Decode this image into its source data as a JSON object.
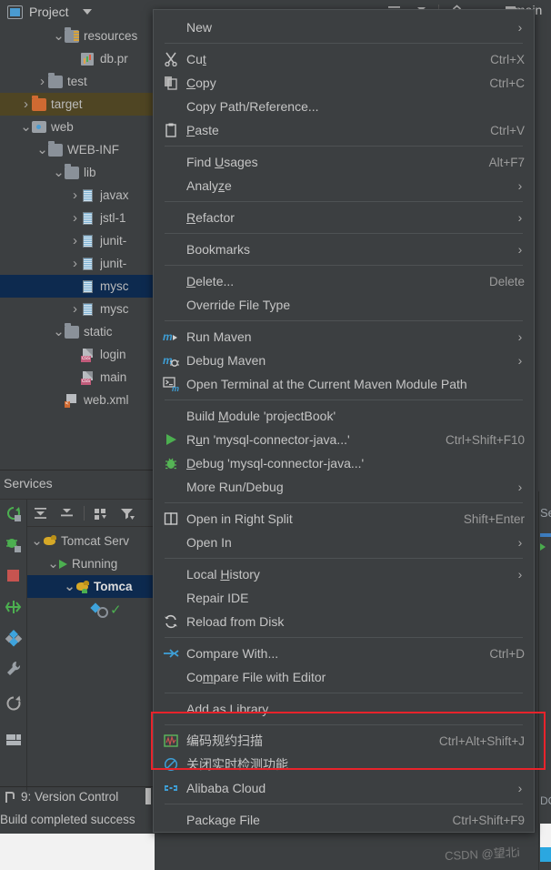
{
  "window": {
    "project_tab_label": "Project",
    "main_branch_label": "main"
  },
  "toolbar": {
    "icons": [
      {
        "name": "expand-all-icon",
        "title": "Expand All"
      },
      {
        "name": "collapse-all-icon",
        "title": "Collapse All"
      },
      {
        "name": "settings-gear-icon",
        "title": "Settings"
      },
      {
        "name": "hide-icon",
        "title": "Hide"
      },
      {
        "name": "vcs-branch-icon",
        "title": "Git Branch"
      }
    ]
  },
  "project_tree": [
    {
      "indent": 3,
      "chevron": "v",
      "icon": "folder-resources-icon",
      "label": "resources",
      "selected": false
    },
    {
      "indent": 4,
      "chevron": "",
      "icon": "properties-file-icon",
      "label": "db.pr",
      "selected": false
    },
    {
      "indent": 2,
      "chevron": ">",
      "icon": "folder-icon",
      "label": "test",
      "selected": false
    },
    {
      "indent": 1,
      "chevron": ">",
      "icon": "folder-target-icon",
      "label": "target",
      "selected": "target"
    },
    {
      "indent": 1,
      "chevron": "v",
      "icon": "web-module-icon",
      "label": "web",
      "selected": false
    },
    {
      "indent": 2,
      "chevron": "v",
      "icon": "folder-icon",
      "label": "WEB-INF",
      "selected": false
    },
    {
      "indent": 3,
      "chevron": "v",
      "icon": "folder-icon",
      "label": "lib",
      "selected": false
    },
    {
      "indent": 4,
      "chevron": ">",
      "icon": "jar-icon",
      "label": "javax",
      "selected": false
    },
    {
      "indent": 4,
      "chevron": ">",
      "icon": "jar-icon",
      "label": "jstl-1",
      "selected": false
    },
    {
      "indent": 4,
      "chevron": ">",
      "icon": "jar-icon",
      "label": "junit-",
      "selected": false
    },
    {
      "indent": 4,
      "chevron": ">",
      "icon": "jar-icon",
      "label": "junit-",
      "selected": false
    },
    {
      "indent": 4,
      "chevron": "",
      "icon": "jar-icon",
      "label": "mysc",
      "selected": "blue"
    },
    {
      "indent": 4,
      "chevron": ">",
      "icon": "jar-icon",
      "label": "mysc",
      "selected": false
    },
    {
      "indent": 3,
      "chevron": "v",
      "icon": "folder-icon",
      "label": "static",
      "selected": false
    },
    {
      "indent": 4,
      "chevron": "",
      "icon": "css-file-icon",
      "label": "login",
      "selected": false
    },
    {
      "indent": 4,
      "chevron": "",
      "icon": "css-file-icon",
      "label": "main",
      "selected": false
    },
    {
      "indent": 3,
      "chevron": "",
      "icon": "xml-file-icon",
      "label": "web.xml",
      "selected": false
    }
  ],
  "services": {
    "title": "Services",
    "toolbar_icons": [
      {
        "name": "expand-all-icon"
      },
      {
        "name": "collapse-all-icon"
      },
      {
        "name": "group-by-icon"
      },
      {
        "name": "filter-icon"
      }
    ],
    "sidebar_icons": [
      {
        "name": "rerun-icon"
      },
      {
        "name": "rerun-debug-icon"
      },
      {
        "name": "stop-icon"
      },
      {
        "name": "redeploy-icon"
      },
      {
        "name": "deploy-icon"
      },
      {
        "name": "wrench-settings-icon"
      },
      {
        "name": "refresh-icon"
      },
      {
        "name": "layout-icon"
      }
    ],
    "tree": [
      {
        "indent": 0,
        "chevron": "v",
        "icon": "tomcat-icon",
        "label": "Tomcat Serv",
        "selected": false,
        "bold": false
      },
      {
        "indent": 1,
        "chevron": "v",
        "icon": "play-icon",
        "label": "Running",
        "selected": false,
        "bold": false
      },
      {
        "indent": 2,
        "chevron": "v",
        "icon": "tomcat-run-icon",
        "label": "Tomca",
        "selected": true,
        "bold": true
      },
      {
        "indent": 3,
        "chevron": "",
        "icon": "deployment-icon",
        "label": "",
        "selected": false,
        "bold": false
      }
    ]
  },
  "status_bar": {
    "vcs_label": "9: Version Control",
    "build_message": "Build completed success"
  },
  "right_edge": {
    "se_label": "Se",
    "doc_label": "DO"
  },
  "context_menu": {
    "items": [
      {
        "type": "item",
        "icon": "",
        "label": "New",
        "shortcut": "",
        "arrow": true,
        "mnemonic": ""
      },
      {
        "type": "sep"
      },
      {
        "type": "item",
        "icon": "cut-icon",
        "label": "Cut",
        "shortcut": "Ctrl+X",
        "arrow": false,
        "mnemonic": "t"
      },
      {
        "type": "item",
        "icon": "copy-icon",
        "label": "Copy",
        "shortcut": "Ctrl+C",
        "arrow": false,
        "mnemonic": "C"
      },
      {
        "type": "item",
        "icon": "",
        "label": "Copy Path/Reference...",
        "shortcut": "",
        "arrow": false,
        "mnemonic": ""
      },
      {
        "type": "item",
        "icon": "paste-icon",
        "label": "Paste",
        "shortcut": "Ctrl+V",
        "arrow": false,
        "mnemonic": "P"
      },
      {
        "type": "sep"
      },
      {
        "type": "item",
        "icon": "",
        "label": "Find Usages",
        "shortcut": "Alt+F7",
        "arrow": false,
        "mnemonic": "U"
      },
      {
        "type": "item",
        "icon": "",
        "label": "Analyze",
        "shortcut": "",
        "arrow": true,
        "mnemonic": "z"
      },
      {
        "type": "sep"
      },
      {
        "type": "item",
        "icon": "",
        "label": "Refactor",
        "shortcut": "",
        "arrow": true,
        "mnemonic": "R"
      },
      {
        "type": "sep"
      },
      {
        "type": "item",
        "icon": "",
        "label": "Bookmarks",
        "shortcut": "",
        "arrow": true,
        "mnemonic": ""
      },
      {
        "type": "sep"
      },
      {
        "type": "item",
        "icon": "",
        "label": "Delete...",
        "shortcut": "Delete",
        "arrow": false,
        "mnemonic": "D"
      },
      {
        "type": "item",
        "icon": "",
        "label": "Override File Type",
        "shortcut": "",
        "arrow": false,
        "mnemonic": ""
      },
      {
        "type": "sep"
      },
      {
        "type": "item",
        "icon": "maven-run-icon",
        "label": "Run Maven",
        "shortcut": "",
        "arrow": true,
        "mnemonic": ""
      },
      {
        "type": "item",
        "icon": "maven-debug-icon",
        "label": "Debug Maven",
        "shortcut": "",
        "arrow": true,
        "mnemonic": ""
      },
      {
        "type": "item",
        "icon": "terminal-icon",
        "label": "Open Terminal at the Current Maven Module Path",
        "shortcut": "",
        "arrow": false,
        "mnemonic": ""
      },
      {
        "type": "sep"
      },
      {
        "type": "item",
        "icon": "",
        "label": "Build Module 'projectBook'",
        "shortcut": "",
        "arrow": false,
        "mnemonic": "M"
      },
      {
        "type": "item",
        "icon": "run-icon",
        "label": "Run 'mysql-connector-java...'",
        "shortcut": "Ctrl+Shift+F10",
        "arrow": false,
        "mnemonic": "u"
      },
      {
        "type": "item",
        "icon": "debug-icon",
        "label": "Debug 'mysql-connector-java...'",
        "shortcut": "",
        "arrow": false,
        "mnemonic": "D"
      },
      {
        "type": "item",
        "icon": "",
        "label": "More Run/Debug",
        "shortcut": "",
        "arrow": true,
        "mnemonic": ""
      },
      {
        "type": "sep"
      },
      {
        "type": "item",
        "icon": "split-icon",
        "label": "Open in Right Split",
        "shortcut": "Shift+Enter",
        "arrow": false,
        "mnemonic": ""
      },
      {
        "type": "item",
        "icon": "",
        "label": "Open In",
        "shortcut": "",
        "arrow": true,
        "mnemonic": ""
      },
      {
        "type": "sep"
      },
      {
        "type": "item",
        "icon": "",
        "label": "Local History",
        "shortcut": "",
        "arrow": true,
        "mnemonic": "H"
      },
      {
        "type": "item",
        "icon": "",
        "label": "Repair IDE",
        "shortcut": "",
        "arrow": false,
        "mnemonic": ""
      },
      {
        "type": "item",
        "icon": "reload-icon",
        "label": "Reload from Disk",
        "shortcut": "",
        "arrow": false,
        "mnemonic": ""
      },
      {
        "type": "sep"
      },
      {
        "type": "item",
        "icon": "compare-icon",
        "label": "Compare With...",
        "shortcut": "Ctrl+D",
        "arrow": false,
        "mnemonic": ""
      },
      {
        "type": "item",
        "icon": "",
        "label": "Compare File with Editor",
        "shortcut": "",
        "arrow": false,
        "mnemonic": "m"
      },
      {
        "type": "sep"
      },
      {
        "type": "item",
        "icon": "",
        "label": "Add as Library...",
        "shortcut": "",
        "arrow": false,
        "mnemonic": "",
        "highlighted": true
      },
      {
        "type": "sep"
      },
      {
        "type": "item",
        "icon": "code-scan-icon",
        "label": "编码规约扫描",
        "shortcut": "Ctrl+Alt+Shift+J",
        "arrow": false,
        "mnemonic": ""
      },
      {
        "type": "item",
        "icon": "disable-icon",
        "label": "关闭实时检测功能",
        "shortcut": "",
        "arrow": false,
        "mnemonic": ""
      },
      {
        "type": "item",
        "icon": "alibaba-cloud-icon",
        "label": "Alibaba Cloud",
        "shortcut": "",
        "arrow": true,
        "mnemonic": ""
      },
      {
        "type": "sep"
      },
      {
        "type": "item",
        "icon": "",
        "label": "Package File",
        "shortcut": "Ctrl+Shift+F9",
        "arrow": false,
        "mnemonic": ""
      }
    ]
  },
  "annotation": {
    "highlight_color": "#e8232b"
  },
  "watermark": {
    "text": "CSDN @望北i"
  }
}
